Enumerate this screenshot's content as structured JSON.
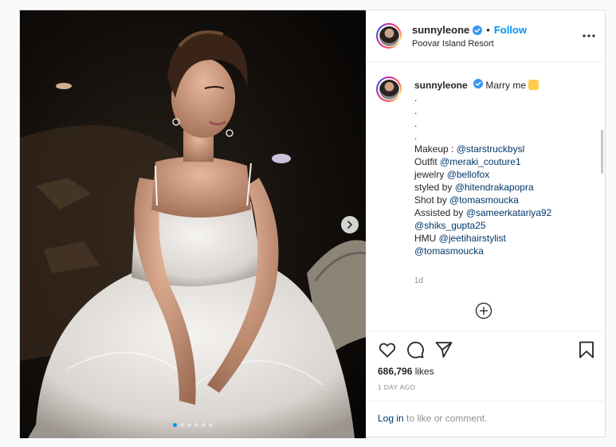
{
  "header": {
    "username": "sunnyleone",
    "separator": "•",
    "follow_label": "Follow",
    "location": "Poovar Island Resort"
  },
  "caption": {
    "username": "sunnyleone",
    "first_text": "Marry me",
    "dots": [
      ".",
      ".",
      ".",
      "."
    ],
    "lines": [
      {
        "prefix": "Makeup : ",
        "mention": "@starstruckbysl"
      },
      {
        "prefix": "Outfit ",
        "mention": "@meraki_couture1"
      },
      {
        "prefix": "jewelry ",
        "mention": "@bellofox"
      },
      {
        "prefix": "styled by ",
        "mention": "@hitendrakapopra"
      },
      {
        "prefix": "Shot by ",
        "mention": "@tomasmoucka"
      },
      {
        "prefix": "Assisted by ",
        "mention": "@sameerkatariya92"
      },
      {
        "prefix": "",
        "mention": "@shiks_gupta25"
      },
      {
        "prefix": "HMU ",
        "mention": "@jeetihairstylist"
      },
      {
        "prefix": "",
        "mention": "@tomasmoucka"
      }
    ],
    "timestamp": "1d"
  },
  "icons": {
    "verified": "verified-badge-icon",
    "more": "more-options-icon",
    "like": "heart-icon",
    "comment": "comment-bubble-icon",
    "share": "paper-plane-icon",
    "save": "bookmark-icon",
    "load_more": "plus-circle-icon",
    "next": "chevron-right-icon",
    "emoji": "emoji-icon"
  },
  "stats": {
    "likes_count": "686,796",
    "likes_label": " likes",
    "post_date": "1 DAY AGO"
  },
  "login": {
    "link_label": "Log in",
    "suffix": " to like or comment."
  },
  "carousel": {
    "total": 6,
    "active_index": 0
  },
  "colors": {
    "accent": "#0095f6",
    "mention": "#00376b",
    "muted": "#8e8e8e",
    "border": "#dbdbdb"
  }
}
